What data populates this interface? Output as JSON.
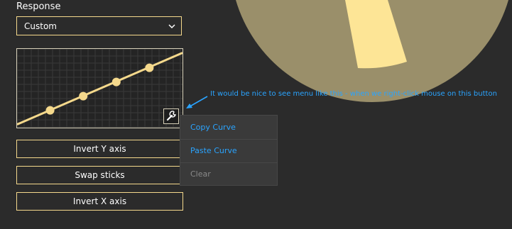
{
  "response": {
    "label": "Response",
    "dropdown_value": "Custom"
  },
  "curve_editor": {
    "curve_color": "#f5d98c",
    "points": [
      {
        "x": 0.2,
        "y": 0.22
      },
      {
        "x": 0.4,
        "y": 0.4
      },
      {
        "x": 0.6,
        "y": 0.58
      },
      {
        "x": 0.8,
        "y": 0.76
      }
    ],
    "icon": "wrench-icon"
  },
  "buttons": {
    "invert_y": "Invert Y axis",
    "swap_sticks": "Swap sticks",
    "invert_x": "Invert X axis"
  },
  "context_menu": {
    "copy": "Copy Curve",
    "paste": "Paste Curve",
    "clear": "Clear"
  },
  "annotation": {
    "text": "It would be nice to see menu like this - when we right-click mouse on this button",
    "color": "#2aa4ff"
  },
  "colors": {
    "accent": "#f5d98c",
    "background": "#2b2b2b",
    "dial_outer": "#9a8f6a",
    "dial_highlight": "#fde596"
  }
}
